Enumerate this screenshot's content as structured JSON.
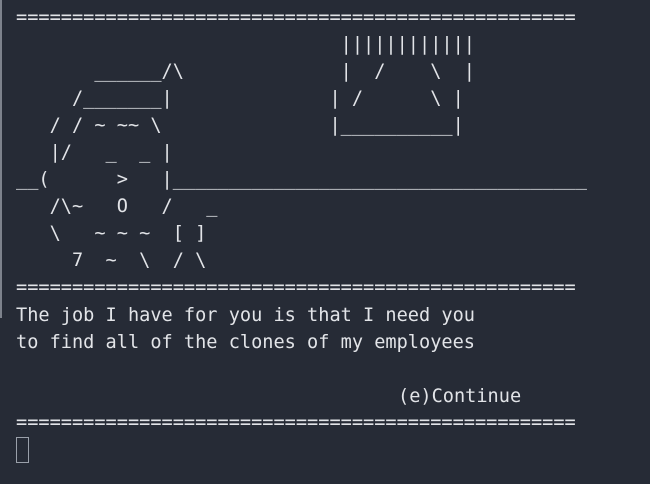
{
  "ascii_art": {
    "lines": [
      "==================================================",
      "                             ||||||||||||",
      "       ______/\\              |  /    \\  |",
      "     /_______|              | /      \\ |",
      "   / / ~ ~~ \\               |__________|",
      "   |/   _  _ |",
      "__(      >   |_____________________________________",
      "   /\\~   O   /   _",
      "   \\   ~ ~ ~  [ ]",
      "     7  ~  \\  / \\",
      "=================================================="
    ]
  },
  "dialog": {
    "line1": "The job I have for you is that I need you",
    "line2": "to find all of the clones of my employees"
  },
  "options": {
    "continue_label": "(e)Continue"
  },
  "divider_bottom": "=================================================="
}
